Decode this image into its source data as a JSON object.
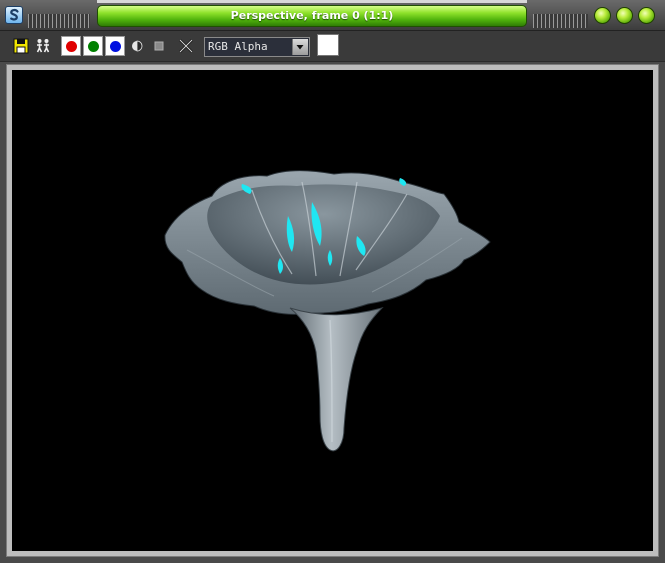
{
  "window": {
    "title": "Perspective, frame 0 (1:1)"
  },
  "toolbar": {
    "channel_select": {
      "value": "RGB Alpha"
    },
    "buttons": {
      "save": "save-icon",
      "clone": "clone-icon",
      "red_channel": "red-channel-icon",
      "green_channel": "green-channel-icon",
      "blue_channel": "blue-channel-icon",
      "monochrome": "monochrome-icon",
      "alpha_toggle": "alpha-icon",
      "clear": "clear-icon"
    },
    "swatch_color": "#ffffff"
  },
  "colors": {
    "title_bar_green": "#6cd11c",
    "window_chrome": "#3a3a3a",
    "render_background": "#000000",
    "red_dot": "#e00000",
    "green_dot": "#008000",
    "blue_dot": "#0010e0",
    "flower_highlight": "#1fe7f2"
  }
}
